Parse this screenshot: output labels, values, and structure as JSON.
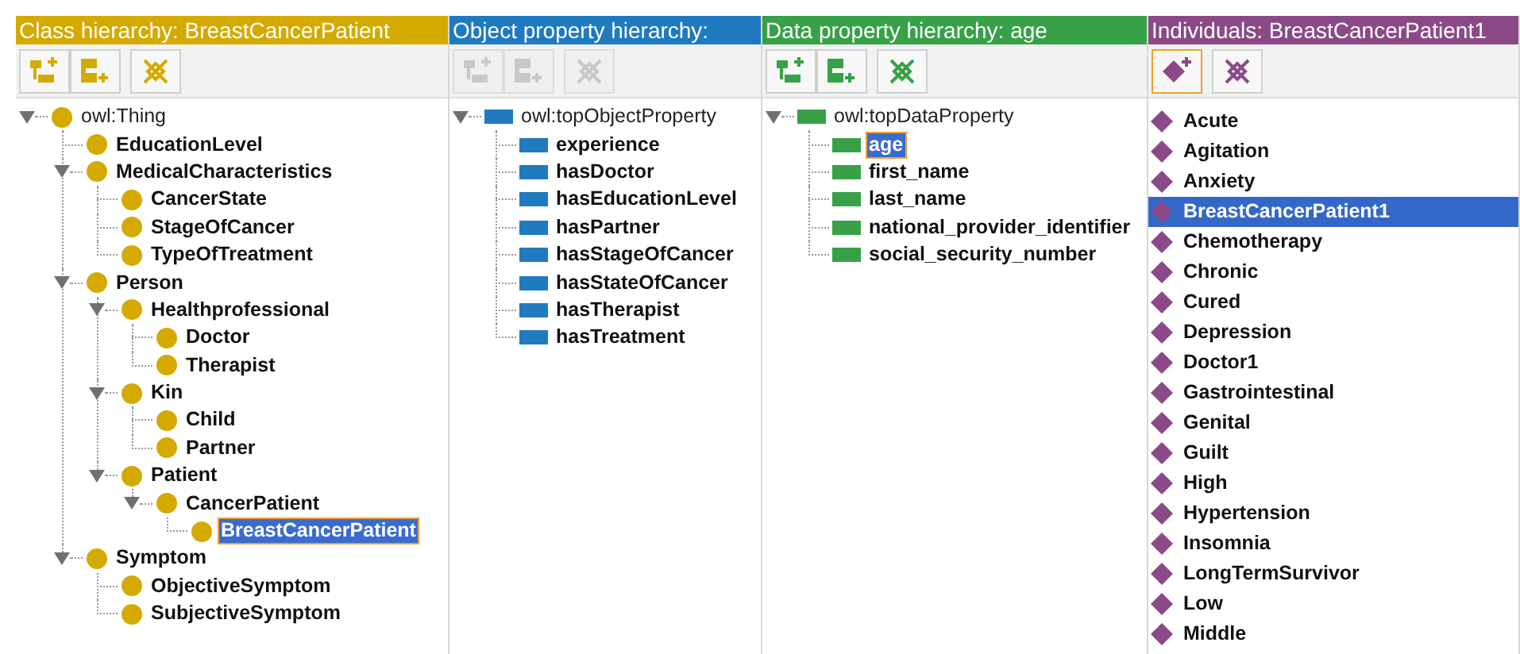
{
  "panels": [
    {
      "kind": "class",
      "title": "Class hierarchy: BreastCancerPatient",
      "toolbar": [
        {
          "kind": "add-child",
          "disabled": false
        },
        {
          "kind": "add-sibling",
          "disabled": false
        },
        {
          "kind": "delete",
          "disabled": false
        }
      ],
      "tree": [
        {
          "label": "owl:Thing",
          "expanded": true,
          "selected": false,
          "children": [
            {
              "label": "EducationLevel",
              "selected": false
            },
            {
              "label": "MedicalCharacteristics",
              "expanded": true,
              "selected": false,
              "children": [
                {
                  "label": "CancerState",
                  "selected": false
                },
                {
                  "label": "StageOfCancer",
                  "selected": false
                },
                {
                  "label": "TypeOfTreatment",
                  "selected": false
                }
              ]
            },
            {
              "label": "Person",
              "expanded": true,
              "selected": false,
              "children": [
                {
                  "label": "Healthprofessional",
                  "expanded": true,
                  "selected": false,
                  "children": [
                    {
                      "label": "Doctor",
                      "selected": false
                    },
                    {
                      "label": "Therapist",
                      "selected": false
                    }
                  ]
                },
                {
                  "label": "Kin",
                  "expanded": true,
                  "selected": false,
                  "children": [
                    {
                      "label": "Child",
                      "selected": false
                    },
                    {
                      "label": "Partner",
                      "selected": false
                    }
                  ]
                },
                {
                  "label": "Patient",
                  "expanded": true,
                  "selected": false,
                  "children": [
                    {
                      "label": "CancerPatient",
                      "expanded": true,
                      "selected": false,
                      "children": [
                        {
                          "label": "BreastCancerPatient",
                          "selected": true
                        }
                      ]
                    }
                  ]
                }
              ]
            },
            {
              "label": "Symptom",
              "expanded": true,
              "selected": false,
              "children": [
                {
                  "label": "ObjectiveSymptom",
                  "selected": false
                },
                {
                  "label": "SubjectiveSymptom",
                  "selected": false
                }
              ]
            }
          ]
        }
      ]
    },
    {
      "kind": "object",
      "title": "Object property hierarchy:",
      "toolbar": [
        {
          "kind": "add-child",
          "disabled": true
        },
        {
          "kind": "add-sibling",
          "disabled": true
        },
        {
          "kind": "delete",
          "disabled": true
        }
      ],
      "tree": [
        {
          "label": "owl:topObjectProperty",
          "expanded": true,
          "selected": false,
          "children": [
            {
              "label": "experience",
              "selected": false
            },
            {
              "label": "hasDoctor",
              "selected": false
            },
            {
              "label": "hasEducationLevel",
              "selected": false
            },
            {
              "label": "hasPartner",
              "selected": false
            },
            {
              "label": "hasStageOfCancer",
              "selected": false
            },
            {
              "label": "hasStateOfCancer",
              "selected": false
            },
            {
              "label": "hasTherapist",
              "selected": false
            },
            {
              "label": "hasTreatment",
              "selected": false
            }
          ]
        }
      ]
    },
    {
      "kind": "data",
      "title": "Data property hierarchy: age",
      "toolbar": [
        {
          "kind": "add-child",
          "disabled": false
        },
        {
          "kind": "add-sibling",
          "disabled": false
        },
        {
          "kind": "delete",
          "disabled": false
        }
      ],
      "tree": [
        {
          "label": "owl:topDataProperty",
          "expanded": true,
          "selected": false,
          "children": [
            {
              "label": "age",
              "selected": true
            },
            {
              "label": "first_name",
              "selected": false
            },
            {
              "label": "last_name",
              "selected": false
            },
            {
              "label": "national_provider_identifier",
              "selected": false
            },
            {
              "label": "social_security_number",
              "selected": false
            }
          ]
        }
      ]
    },
    {
      "kind": "individual",
      "title": "Individuals: BreastCancerPatient1",
      "toolbar": [
        {
          "kind": "add-individual",
          "disabled": false
        },
        {
          "kind": "delete",
          "disabled": false
        }
      ],
      "list": [
        {
          "label": "Acute",
          "selected": false
        },
        {
          "label": "Agitation",
          "selected": false
        },
        {
          "label": "Anxiety",
          "selected": false
        },
        {
          "label": "BreastCancerPatient1",
          "selected": true
        },
        {
          "label": "Chemotherapy",
          "selected": false
        },
        {
          "label": "Chronic",
          "selected": false
        },
        {
          "label": "Cured",
          "selected": false
        },
        {
          "label": "Depression",
          "selected": false
        },
        {
          "label": "Doctor1",
          "selected": false
        },
        {
          "label": "Gastrointestinal",
          "selected": false
        },
        {
          "label": "Genital",
          "selected": false
        },
        {
          "label": "Guilt",
          "selected": false
        },
        {
          "label": "High",
          "selected": false
        },
        {
          "label": "Hypertension",
          "selected": false
        },
        {
          "label": "Insomnia",
          "selected": false
        },
        {
          "label": "LongTermSurvivor",
          "selected": false
        },
        {
          "label": "Low",
          "selected": false
        },
        {
          "label": "Middle",
          "selected": false
        }
      ]
    }
  ]
}
